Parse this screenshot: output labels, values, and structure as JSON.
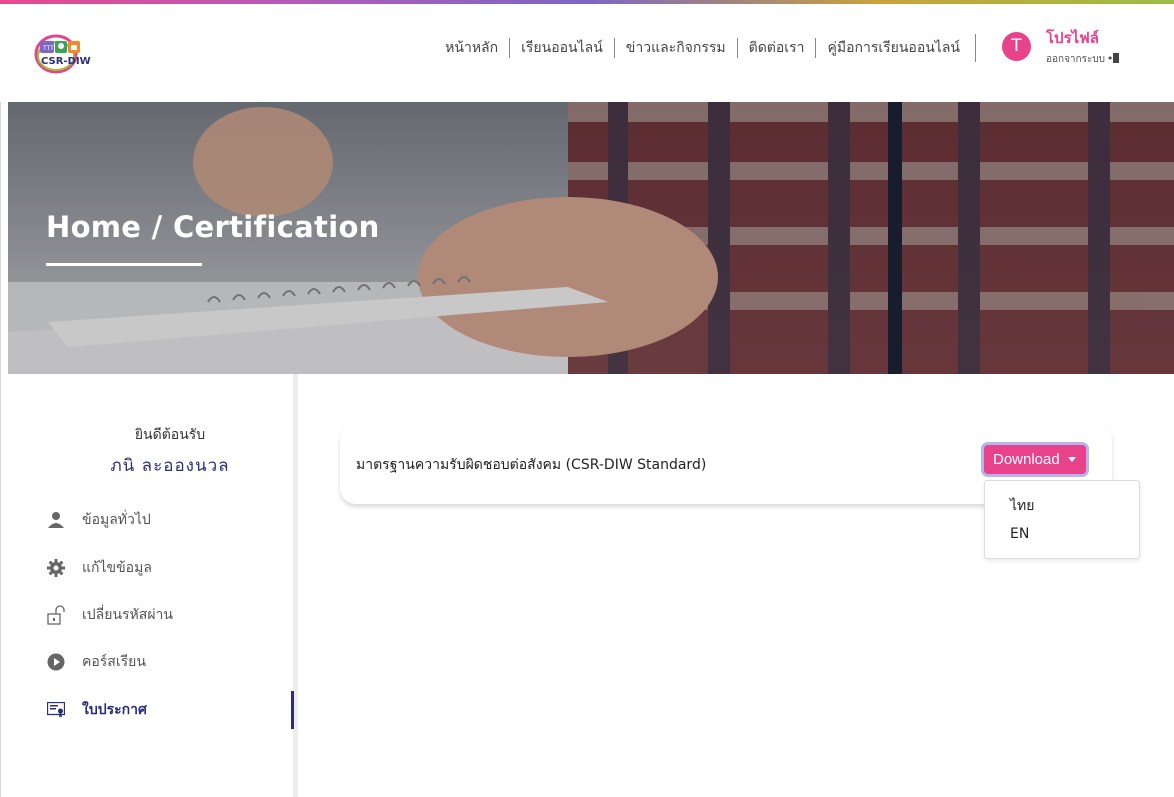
{
  "colors": {
    "accent": "#e8428a",
    "navy": "#2b2d7a",
    "focus_ring": "#b6b4ec"
  },
  "header": {
    "logo_text": "CSR-DIW",
    "nav": [
      "หน้าหลัก",
      "เรียนออนไลน์",
      "ข่าวและกิจกรรม",
      "ติดต่อเรา",
      "คู่มือการเรียนออนไลน์"
    ],
    "avatar_letter": "T",
    "profile_label": "โปรไฟล์",
    "logout_label": "ออกจากระบบ"
  },
  "hero": {
    "breadcrumb": "Home / Certification"
  },
  "sidebar": {
    "welcome": "ยินดีต้อนรับ",
    "user_name": "ภนิ  ละอองนวล",
    "items": [
      {
        "label": "ข้อมูลทั่วไป",
        "icon": "user-icon"
      },
      {
        "label": "แก้ไขข้อมูล",
        "icon": "gear-icon"
      },
      {
        "label": "เปลี่ยนรหัสผ่าน",
        "icon": "unlock-icon"
      },
      {
        "label": "คอร์สเรียน",
        "icon": "play-icon"
      },
      {
        "label": "ใบประกาศ",
        "icon": "certificate-icon",
        "active": true
      }
    ]
  },
  "main": {
    "certificate_title": "มาตรฐานความรับผิดชอบต่อสังคม (CSR-DIW Standard)",
    "download_label": "Download",
    "download_options": [
      "ไทย",
      "EN"
    ]
  }
}
